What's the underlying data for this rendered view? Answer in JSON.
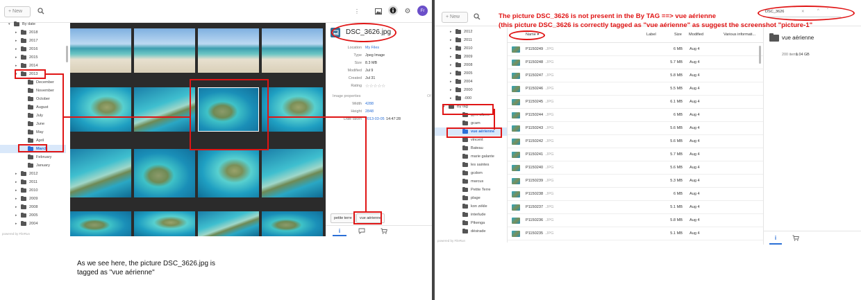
{
  "left": {
    "new_button": "+ New",
    "search_icon": "search-icon",
    "avatar": "Fr",
    "tree": [
      {
        "label": "By date",
        "tri": "▾",
        "indent": 0
      },
      {
        "label": "2018",
        "tri": "▸",
        "indent": 1
      },
      {
        "label": "2017",
        "tri": "▸",
        "indent": 1
      },
      {
        "label": "2016",
        "tri": "▸",
        "indent": 1
      },
      {
        "label": "2015",
        "tri": "▸",
        "indent": 1
      },
      {
        "label": "2014",
        "tri": "▸",
        "indent": 1
      },
      {
        "label": "2013",
        "tri": "▾",
        "indent": 1
      },
      {
        "label": "December",
        "tri": "",
        "indent": 2
      },
      {
        "label": "November",
        "tri": "",
        "indent": 2
      },
      {
        "label": "October",
        "tri": "",
        "indent": 2
      },
      {
        "label": "August",
        "tri": "",
        "indent": 2
      },
      {
        "label": "July",
        "tri": "",
        "indent": 2
      },
      {
        "label": "June",
        "tri": "",
        "indent": 2
      },
      {
        "label": "May",
        "tri": "",
        "indent": 2
      },
      {
        "label": "April",
        "tri": "",
        "indent": 2
      },
      {
        "label": "March",
        "tri": "",
        "indent": 2,
        "selected": true
      },
      {
        "label": "February",
        "tri": "",
        "indent": 2
      },
      {
        "label": "January",
        "tri": "",
        "indent": 2
      },
      {
        "label": "2012",
        "tri": "▸",
        "indent": 1
      },
      {
        "label": "2011",
        "tri": "▸",
        "indent": 1
      },
      {
        "label": "2010",
        "tri": "▸",
        "indent": 1
      },
      {
        "label": "2009",
        "tri": "▸",
        "indent": 1
      },
      {
        "label": "2008",
        "tri": "▸",
        "indent": 1
      },
      {
        "label": "2005",
        "tri": "▸",
        "indent": 1
      },
      {
        "label": "2004",
        "tri": "▸",
        "indent": 1
      }
    ],
    "powered_by": "powered by FileRun",
    "details": {
      "file_name": "DSC_3626.jpg",
      "location_label": "Location",
      "location_value": "My Files",
      "type_label": "Type",
      "type_value": "Jpeg Image",
      "size_label": "Size",
      "size_value": "8.3 MB",
      "modified_label": "Modified",
      "modified_value": "Jul 9",
      "created_label": "Created",
      "created_value": "Jul 31",
      "rating_label": "Rating",
      "rating_value": "☆☆☆☆☆",
      "image_properties": "Image properties",
      "width_label": "Width",
      "width_value": "4288",
      "height_label": "Height",
      "height_value": "2848",
      "date_taken_label": "Date taken",
      "date_taken_value": "2013-03-05",
      "date_taken_time": "14:47:28",
      "tags": [
        "petite terre",
        "vue aérienne"
      ]
    },
    "annotation": "As we see here, the picture DSC_3626.jpg is tagged as \"vue aérienne\""
  },
  "right": {
    "new_button": "+ New",
    "search_value": "DSC_3626",
    "search_clear": "✕",
    "tree": [
      {
        "label": "2012",
        "tri": "▸",
        "indent": 1
      },
      {
        "label": "2011",
        "tri": "▸",
        "indent": 1
      },
      {
        "label": "2010",
        "tri": "▸",
        "indent": 1
      },
      {
        "label": "2009",
        "tri": "▸",
        "indent": 1
      },
      {
        "label": "2008",
        "tri": "▸",
        "indent": 1
      },
      {
        "label": "2005",
        "tri": "▸",
        "indent": 1
      },
      {
        "label": "2004",
        "tri": "▸",
        "indent": 1
      },
      {
        "label": "2000",
        "tri": "▸",
        "indent": 1
      },
      {
        "label": "-000",
        "tri": "▸",
        "indent": 1
      },
      {
        "label": "By tag",
        "tri": "▾",
        "indent": 0
      },
      {
        "label": "gyro alizes",
        "tri": "",
        "indent": 2
      },
      {
        "label": "gcam",
        "tri": "",
        "indent": 2
      },
      {
        "label": "vue aérienne",
        "tri": "",
        "indent": 2,
        "selected": true
      },
      {
        "label": "vincent",
        "tri": "",
        "indent": 2
      },
      {
        "label": "Bateau",
        "tri": "",
        "indent": 2
      },
      {
        "label": "marie galante",
        "tri": "",
        "indent": 2
      },
      {
        "label": "les saintes",
        "tri": "",
        "indent": 2
      },
      {
        "label": "gcdom",
        "tri": "",
        "indent": 2
      },
      {
        "label": "marcus",
        "tri": "",
        "indent": 2
      },
      {
        "label": "Petite Terre",
        "tri": "",
        "indent": 2
      },
      {
        "label": "plage",
        "tri": "",
        "indent": 2
      },
      {
        "label": "kon zékle",
        "tri": "",
        "indent": 2
      },
      {
        "label": "interlude",
        "tri": "",
        "indent": 2
      },
      {
        "label": "Pikenga",
        "tri": "",
        "indent": 2
      },
      {
        "label": "désirade",
        "tri": "",
        "indent": 2
      }
    ],
    "powered_by": "powered by FileRun",
    "columns": {
      "name": "Name ▾",
      "label": "Label",
      "size": "Size",
      "modified": "Modified",
      "various": "Various informati..."
    },
    "files": [
      {
        "name": "P1150249",
        "ext": ".JPG",
        "size": "6 MB",
        "modified": "Aug 4"
      },
      {
        "name": "P1150248",
        "ext": ".JPG",
        "size": "5.7 MB",
        "modified": "Aug 4"
      },
      {
        "name": "P1150247",
        "ext": ".JPG",
        "size": "5.8 MB",
        "modified": "Aug 4"
      },
      {
        "name": "P1150246",
        "ext": ".JPG",
        "size": "5.5 MB",
        "modified": "Aug 4"
      },
      {
        "name": "P1150245",
        "ext": ".JPG",
        "size": "6.1 MB",
        "modified": "Aug 4"
      },
      {
        "name": "P1150244",
        "ext": ".JPG",
        "size": "6 MB",
        "modified": "Aug 4"
      },
      {
        "name": "P1150243",
        "ext": ".JPG",
        "size": "5.6 MB",
        "modified": "Aug 4"
      },
      {
        "name": "P1150242",
        "ext": ".JPG",
        "size": "5.6 MB",
        "modified": "Aug 4"
      },
      {
        "name": "P1150241",
        "ext": ".JPG",
        "size": "5.7 MB",
        "modified": "Aug 4"
      },
      {
        "name": "P1150240",
        "ext": ".JPG",
        "size": "5.6 MB",
        "modified": "Aug 4"
      },
      {
        "name": "P1150239",
        "ext": ".JPG",
        "size": "5.3 MB",
        "modified": "Aug 4"
      },
      {
        "name": "P1150238",
        "ext": ".JPG",
        "size": "6 MB",
        "modified": "Aug 4"
      },
      {
        "name": "P1150237",
        "ext": ".JPG",
        "size": "5.1 MB",
        "modified": "Aug 4"
      },
      {
        "name": "P1150236",
        "ext": ".JPG",
        "size": "5.8 MB",
        "modified": "Aug 4"
      },
      {
        "name": "P1150235",
        "ext": ".JPG",
        "size": "5.1 MB",
        "modified": "Aug 4"
      }
    ],
    "folder_title": "vue aérienne",
    "folder_info": "200 items",
    "folder_size": "1.04 GB",
    "annotation_line1": "The picture DSC_3626 is not present in the By TAG ==> vue aérienne",
    "annotation_line2": "(this picture DSC_3626 is correctly tagged as \"vue aérienne\" as suggest the screenshot \"picture-1\""
  }
}
